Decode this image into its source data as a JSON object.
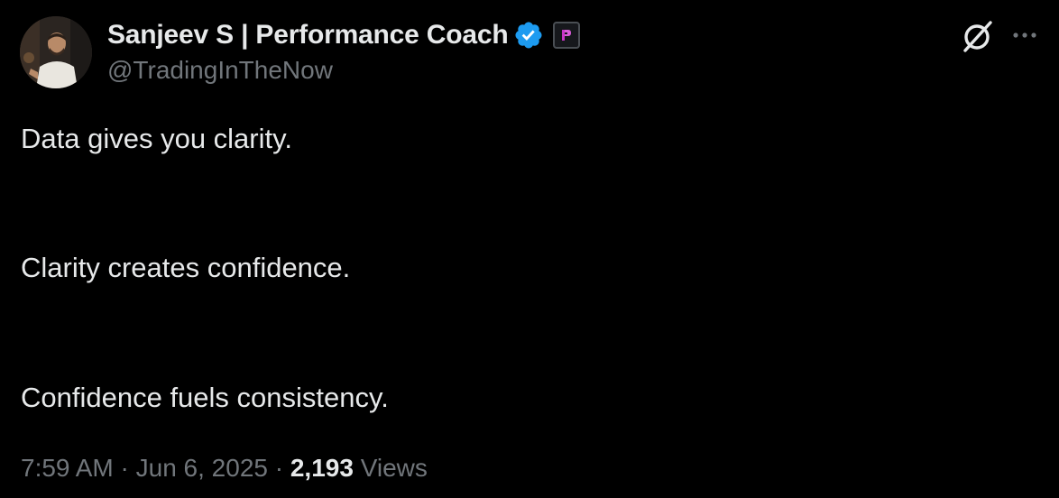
{
  "author": {
    "display_name": "Sanjeev S | Performance Coach",
    "handle": "@TradingInTheNow",
    "verified_icon": "verified-badge-icon",
    "affiliate_icon": "affiliate-badge-icon",
    "avatar": "avatar-photo"
  },
  "actions": {
    "grok_icon": "grok-icon",
    "more_icon": "more-icon"
  },
  "tweet": {
    "lines": [
      "Data gives you clarity.",
      "Clarity creates confidence.",
      "Confidence fuels consistency."
    ]
  },
  "meta": {
    "time": "7:59 AM",
    "separator": " · ",
    "date": "Jun 6, 2025",
    "views_count": "2,193",
    "views_label": " Views"
  },
  "colors": {
    "background": "#000000",
    "primary_text": "#e7e9ea",
    "secondary_text": "#71767b",
    "verified": "#1d9bf0",
    "affiliate_accent": "#c936c9"
  }
}
